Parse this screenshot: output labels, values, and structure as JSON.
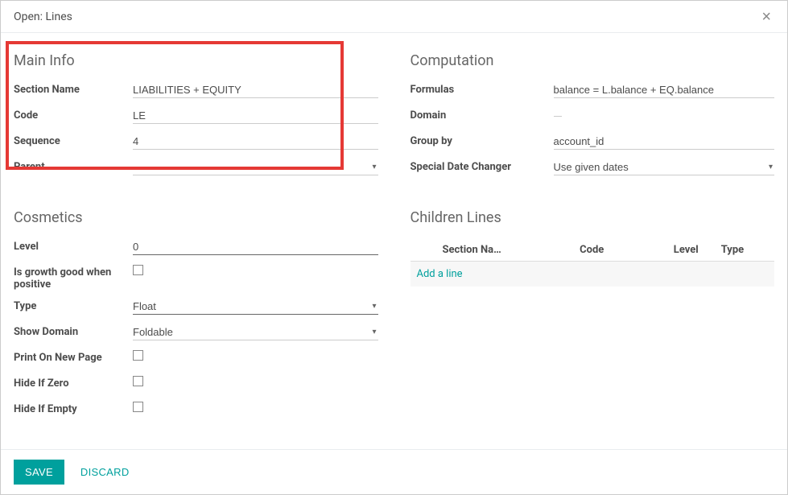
{
  "header": {
    "title": "Open: Lines"
  },
  "mainInfo": {
    "title": "Main Info",
    "labels": {
      "sectionName": "Section Name",
      "code": "Code",
      "sequence": "Sequence",
      "parent": "Parent"
    },
    "values": {
      "sectionName": "LIABILITIES + EQUITY",
      "code": "LE",
      "sequence": "4",
      "parent": ""
    }
  },
  "cosmetics": {
    "title": "Cosmetics",
    "labels": {
      "level": "Level",
      "growth": "Is growth good when positive",
      "type": "Type",
      "showDomain": "Show Domain",
      "printNewPage": "Print On New Page",
      "hideIfZero": "Hide If Zero",
      "hideIfEmpty": "Hide If Empty"
    },
    "values": {
      "level": "0",
      "type": "Float",
      "showDomain": "Foldable"
    }
  },
  "computation": {
    "title": "Computation",
    "labels": {
      "formulas": "Formulas",
      "domain": "Domain",
      "groupBy": "Group by",
      "specialDate": "Special Date Changer"
    },
    "values": {
      "formulas": "balance = L.balance + EQ.balance",
      "domain": "",
      "groupBy": "account_id",
      "specialDate": "Use given dates"
    }
  },
  "children": {
    "title": "Children Lines",
    "columns": {
      "sectionName": "Section Na…",
      "code": "Code",
      "level": "Level",
      "type": "Type"
    },
    "addLine": "Add a line"
  },
  "footer": {
    "save": "SAVE",
    "discard": "DISCARD"
  }
}
